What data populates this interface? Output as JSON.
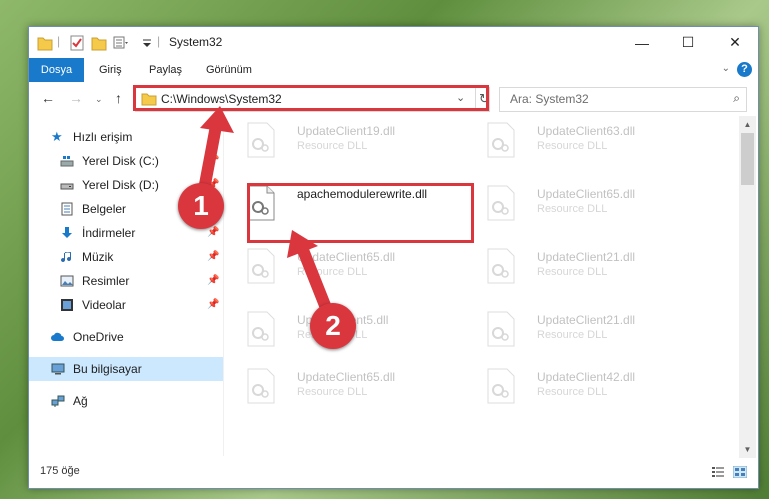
{
  "window": {
    "title": "System32",
    "minimize_glyph": "—",
    "maximize_glyph": "☐",
    "close_glyph": "✕"
  },
  "ribbon": {
    "tabs": [
      {
        "label": "Dosya"
      },
      {
        "label": "Giriş"
      },
      {
        "label": "Paylaş"
      },
      {
        "label": "Görünüm"
      }
    ],
    "help_glyph": "?"
  },
  "navbar": {
    "address": "C:\\Windows\\System32",
    "search_placeholder": "Ara: System32"
  },
  "navpane": {
    "items": [
      {
        "label": "Hızlı erişim",
        "icon": "star-icon",
        "pinned": false
      },
      {
        "label": "Yerel Disk (C:)",
        "icon": "windows-drive-icon",
        "pinned": true
      },
      {
        "label": "Yerel Disk (D:)",
        "icon": "drive-icon",
        "pinned": true
      },
      {
        "label": "Belgeler",
        "icon": "documents-icon",
        "pinned": true
      },
      {
        "label": "İndirmeler",
        "icon": "download-icon",
        "pinned": true
      },
      {
        "label": "Müzik",
        "icon": "music-icon",
        "pinned": true
      },
      {
        "label": "Resimler",
        "icon": "pictures-icon",
        "pinned": true
      },
      {
        "label": "Videolar",
        "icon": "videos-icon",
        "pinned": true
      },
      {
        "label": "OneDrive",
        "icon": "cloud-icon",
        "pinned": false
      },
      {
        "label": "Bu bilgisayar",
        "icon": "computer-icon",
        "pinned": false,
        "selected": true
      },
      {
        "label": "Ağ",
        "icon": "network-icon",
        "pinned": false
      }
    ]
  },
  "files": [
    {
      "name": "UpdateClient19.dll",
      "type": "Resource DLL",
      "faded": true
    },
    {
      "name": "UpdateClient63.dll",
      "type": "Resource DLL",
      "faded": true
    },
    {
      "name": "apachemodulerewrite.dll",
      "type": "",
      "faded": false
    },
    {
      "name": "UpdateClient65.dll",
      "type": "Resource DLL",
      "faded": true
    },
    {
      "name": "UpdateClient65.dll",
      "type": "Resource DLL",
      "faded": true
    },
    {
      "name": "UpdateClient21.dll",
      "type": "Resource DLL",
      "faded": true
    },
    {
      "name": "UpdateClient5.dll",
      "type": "Resource DLL",
      "faded": true
    },
    {
      "name": "UpdateClient21.dll",
      "type": "Resource DLL",
      "faded": true
    },
    {
      "name": "UpdateClient65.dll",
      "type": "Resource DLL",
      "faded": true
    },
    {
      "name": "UpdateClient42.dll",
      "type": "Resource DLL",
      "faded": true
    }
  ],
  "status": {
    "item_count": "175 öğe"
  },
  "annotations": {
    "step1": "1",
    "step2": "2",
    "highlight_color": "#d9363e"
  },
  "colors": {
    "accent": "#1979ca",
    "selection": "#cce8ff"
  }
}
